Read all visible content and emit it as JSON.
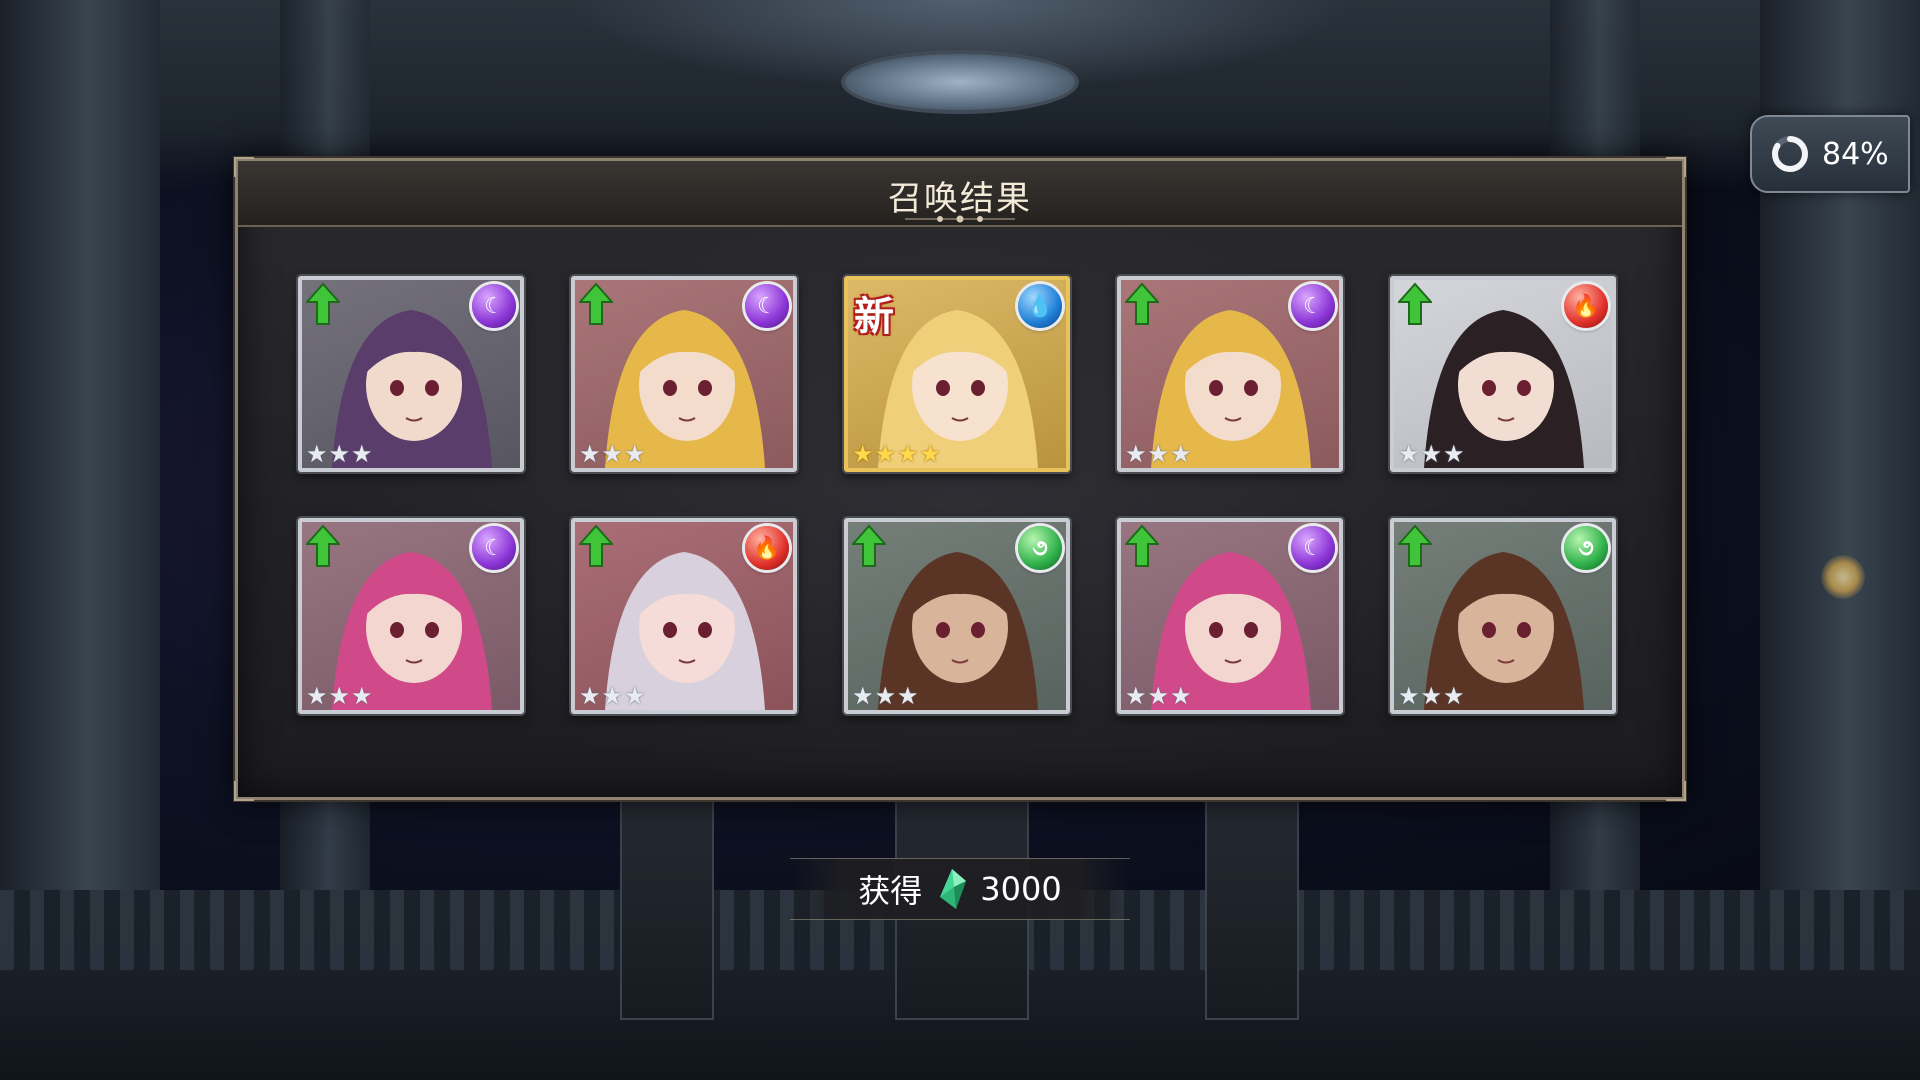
{
  "status": {
    "progress_percent": 84,
    "progress_label": "84%"
  },
  "summon_result": {
    "title": "召唤结果",
    "cards": [
      {
        "rarity_stars": 3,
        "element": "dark",
        "element_icon": "crescent-moon-icon",
        "rank_up": true,
        "new": false,
        "character": "dark-haired horned girl"
      },
      {
        "rarity_stars": 3,
        "element": "dark",
        "element_icon": "crescent-moon-icon",
        "rank_up": true,
        "new": false,
        "character": "blonde masked girl"
      },
      {
        "rarity_stars": 4,
        "element": "water",
        "element_icon": "water-drop-icon",
        "rank_up": false,
        "new": true,
        "new_label": "新",
        "character": "blonde girl"
      },
      {
        "rarity_stars": 3,
        "element": "dark",
        "element_icon": "crescent-moon-icon",
        "rank_up": true,
        "new": false,
        "character": "blonde masked girl"
      },
      {
        "rarity_stars": 3,
        "element": "fire",
        "element_icon": "flame-icon",
        "rank_up": true,
        "new": false,
        "character": "dark-haired red-eyed boy"
      },
      {
        "rarity_stars": 3,
        "element": "dark",
        "element_icon": "crescent-moon-icon",
        "rank_up": true,
        "new": false,
        "character": "pink-haired woman"
      },
      {
        "rarity_stars": 3,
        "element": "fire",
        "element_icon": "flame-icon",
        "rank_up": true,
        "new": false,
        "character": "silver-haired girl with sword"
      },
      {
        "rarity_stars": 3,
        "element": "wind",
        "element_icon": "wind-swirl-icon",
        "rank_up": true,
        "new": false,
        "character": "bearded brown-haired man"
      },
      {
        "rarity_stars": 3,
        "element": "dark",
        "element_icon": "crescent-moon-icon",
        "rank_up": true,
        "new": false,
        "character": "pink-haired woman"
      },
      {
        "rarity_stars": 3,
        "element": "wind",
        "element_icon": "wind-swirl-icon",
        "rank_up": true,
        "new": false,
        "character": "bearded brown-haired man"
      }
    ]
  },
  "reward": {
    "label": "获得",
    "icon": "green-crystal-icon",
    "amount": "3000"
  },
  "colors": {
    "dark": "#8b35d6",
    "water": "#1f7fd6",
    "fire": "#e2322a",
    "wind": "#2fb14a",
    "rank_up_arrow": "#3fc43a",
    "frame_silver": "#c9ccd2",
    "frame_gold": "#e9c35a",
    "gem": "#3fd08a"
  }
}
